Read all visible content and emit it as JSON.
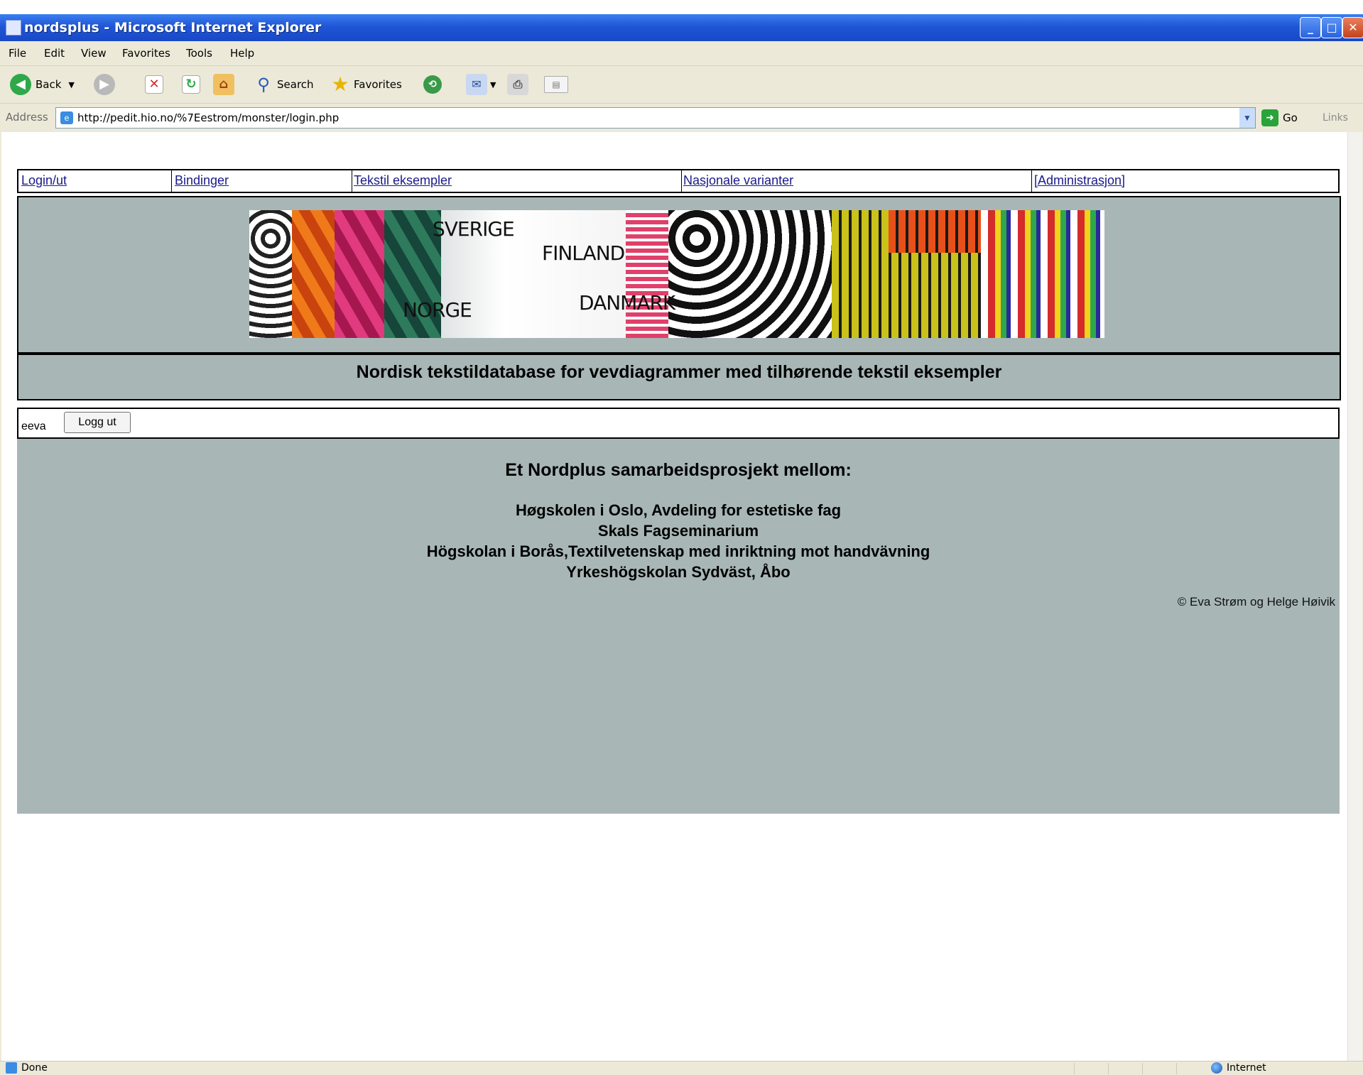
{
  "window": {
    "title": "nordsplus - Microsoft Internet Explorer",
    "menu": [
      "File",
      "Edit",
      "View",
      "Favorites",
      "Tools",
      "Help"
    ],
    "toolbar": {
      "back_label": "Back",
      "search_label": "Search",
      "favorites_label": "Favorites"
    },
    "address": {
      "label": "Address",
      "url": "http://pedit.hio.no/%7Eestrom/monster/login.php",
      "go_label": "Go",
      "links_label": "Links"
    },
    "status": {
      "left": "Done",
      "zone": "Internet"
    }
  },
  "nav": {
    "items": [
      "Login/ut",
      "Bindinger",
      "Tekstil eksempler",
      "Nasjonale varianter",
      "[Administrasjon]"
    ]
  },
  "banner": {
    "countries": [
      "SVERIGE",
      "FINLAND",
      "NORGE",
      "DANMARK"
    ]
  },
  "page": {
    "heading": "Nordisk tekstildatabase for vevdiagrammer med tilhørende tekstil eksempler"
  },
  "login": {
    "username": "eeva",
    "logout_label": "Logg ut"
  },
  "content": {
    "collab_heading": "Et Nordplus samarbeidsprosjekt mellom:",
    "partners": [
      "Høgskolen i Oslo, Avdeling for estetiske fag",
      "Skals Fagseminarium",
      "Högskolan i Borås,Textilvetenskap med inriktning mot handvävning",
      "Yrkeshögskolan Sydväst, Åbo"
    ],
    "copyright": "© Eva Strøm og Helge Høivik"
  },
  "colors": {
    "panel": "#a8b7b6",
    "titlebar": "#1f56d6",
    "chrome": "#ece9d8",
    "link": "#1a1a8a"
  }
}
